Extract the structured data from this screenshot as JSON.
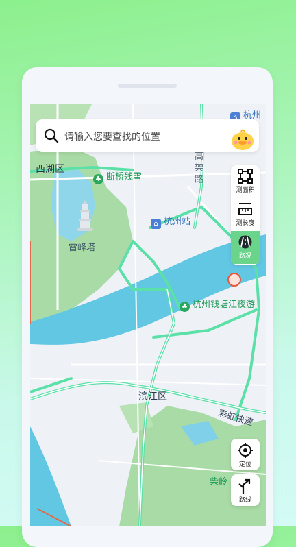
{
  "search": {
    "placeholder": "请输入您要查找的位置"
  },
  "map_labels": {
    "district_xihu": "西湖区",
    "duanqiao": "断桥残雪",
    "gaojia": [
      "高",
      "架",
      "路"
    ],
    "hangzhou_station": "杭州站",
    "leifeng": "雷峰塔",
    "qiantang_night": "杭州钱塘江夜游",
    "binjiang": "滨江区",
    "caihong": [
      "彩",
      "虹",
      "快",
      "速"
    ],
    "chailing": "柴岭",
    "top_right": "杭州"
  },
  "tools": [
    {
      "label": "测面积",
      "icon": "area-measure-icon"
    },
    {
      "label": "测长度",
      "icon": "length-measure-icon"
    },
    {
      "label": "路况",
      "icon": "traffic-icon",
      "active": true
    }
  ],
  "locate": {
    "label": "定位",
    "icon": "locate-icon"
  },
  "route": {
    "label": "路线",
    "icon": "route-icon"
  },
  "colors": {
    "accent": "#6ad48a",
    "road": "#5be0a8",
    "water": "#62c7e3",
    "park": "#a9dba6"
  }
}
